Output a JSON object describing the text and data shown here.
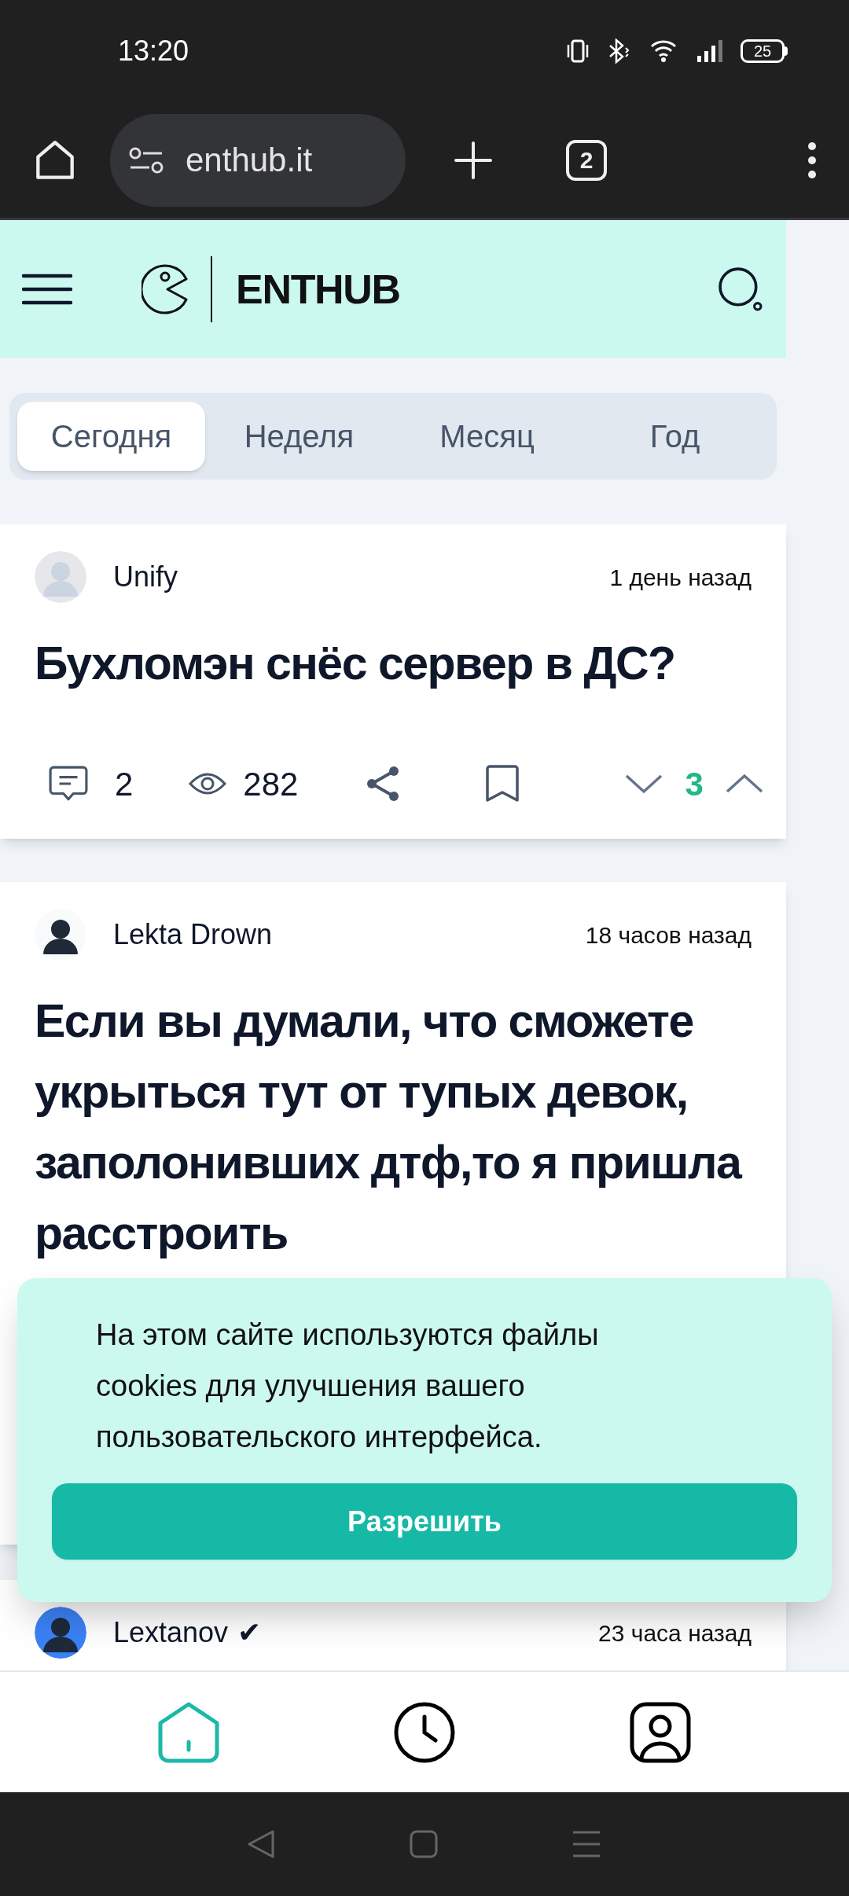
{
  "status_bar": {
    "time": "13:20",
    "battery": "25"
  },
  "browser": {
    "url": "enthub.it",
    "tab_count": "2"
  },
  "site_header": {
    "logo_text": "ENTHUB"
  },
  "period_tabs": [
    {
      "label": "Сегодня",
      "selected": true
    },
    {
      "label": "Неделя",
      "selected": false
    },
    {
      "label": "Месяц",
      "selected": false
    },
    {
      "label": "Год",
      "selected": false
    }
  ],
  "posts": [
    {
      "author": "Unify",
      "time": "1 день назад",
      "title": "Бухломэн снёс сервер в ДС?",
      "comments": "2",
      "views": "282",
      "rating": "3"
    },
    {
      "author": "Lekta Drown",
      "time": "18 часов назад",
      "title": "Если вы думали, что сможете укрыться тут от тупых девок, заполонивших дтф,то я пришла расстроить"
    },
    {
      "author": "Lextanov",
      "badge": "✔",
      "time": "23 часа назад"
    }
  ],
  "cookie_banner": {
    "text": "На этом сайте используются файлы cookies для улучшения вашего пользовательского интерфейса.",
    "button": "Разрешить"
  },
  "bottom_nav": [
    {
      "kind": "home",
      "selected": true
    },
    {
      "kind": "history",
      "selected": false
    },
    {
      "kind": "profile",
      "selected": false
    }
  ]
}
